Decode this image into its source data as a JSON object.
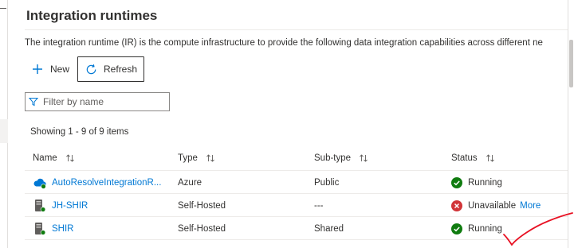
{
  "page": {
    "title": "Integration runtimes",
    "description": "The integration runtime (IR) is the compute infrastructure to provide the following data integration capabilities across different ne"
  },
  "toolbar": {
    "new_label": "New",
    "refresh_label": "Refresh"
  },
  "filter": {
    "placeholder": "Filter by name"
  },
  "list": {
    "showing": "Showing 1 - 9 of 9 items"
  },
  "table": {
    "columns": [
      "Name",
      "Type",
      "Sub-type",
      "Status"
    ],
    "rows": [
      {
        "icon": "cloud-runtime-icon",
        "name": "AutoResolveIntegrationR...",
        "type": "Azure",
        "subtype": "Public",
        "status": "Running",
        "status_icon": "check-circle-icon",
        "extra": ""
      },
      {
        "icon": "server-runtime-icon",
        "name": "JH-SHIR",
        "type": "Self-Hosted",
        "subtype": "---",
        "status": "Unavailable",
        "status_icon": "error-circle-icon",
        "extra": "More"
      },
      {
        "icon": "server-runtime-icon",
        "name": "SHIR",
        "type": "Self-Hosted",
        "subtype": "Shared",
        "status": "Running",
        "status_icon": "check-circle-icon",
        "extra": ""
      }
    ]
  },
  "colors": {
    "accent": "#0078d4",
    "success": "#107c10",
    "error": "#d13438",
    "annotation": "#e81123"
  }
}
